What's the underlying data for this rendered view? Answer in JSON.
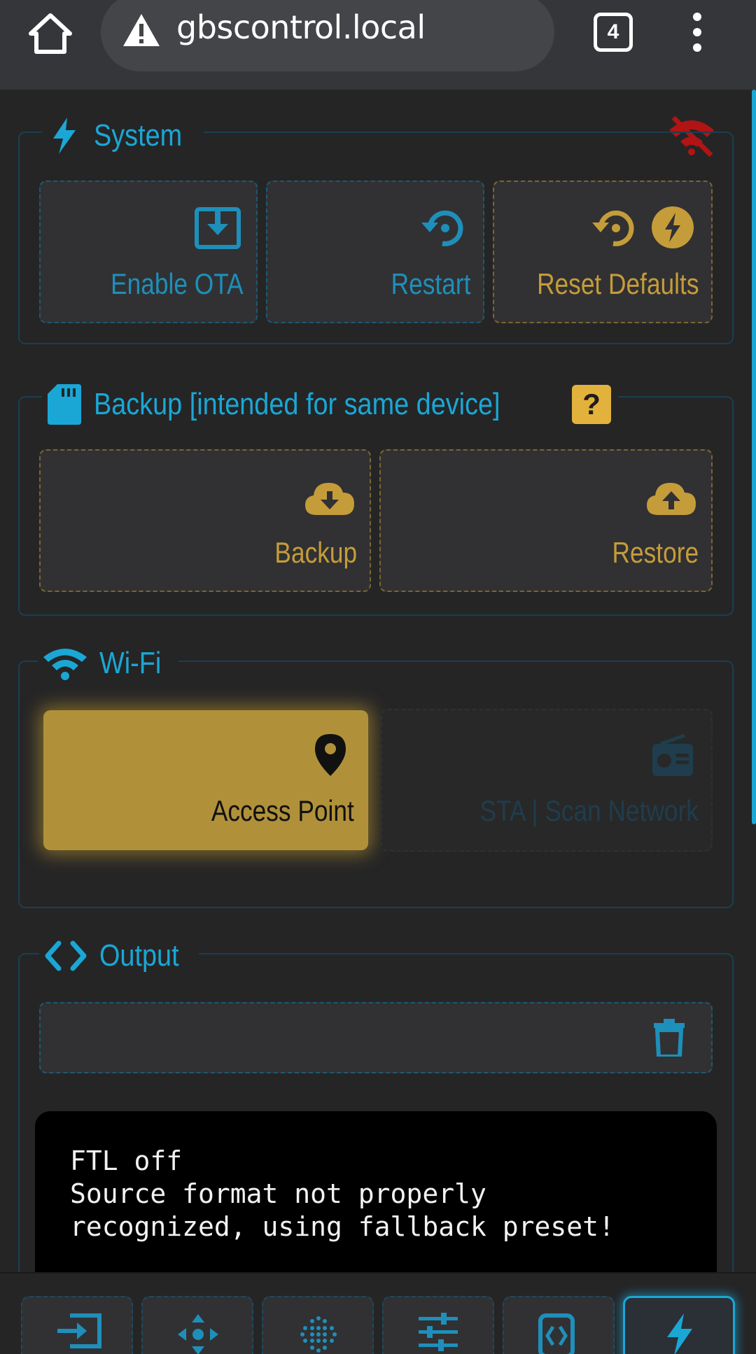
{
  "browser": {
    "url": "gbscontrol.local",
    "tab_count": "4"
  },
  "system": {
    "title": "System",
    "buttons": {
      "enable_ota": "Enable OTA",
      "restart": "Restart",
      "reset_defaults": "Reset Defaults"
    }
  },
  "backup": {
    "title": "Backup [intended for same device]",
    "help_label": "?",
    "buttons": {
      "backup": "Backup",
      "restore": "Restore"
    }
  },
  "wifi": {
    "title": "Wi-Fi",
    "buttons": {
      "access_point": "Access Point",
      "sta_scan": "STA | Scan Network"
    },
    "selected": "Access Point"
  },
  "output": {
    "title": "Output",
    "console_lines": [
      "FTL off",
      "Source format not properly",
      "recognized, using fallback preset!"
    ]
  },
  "colors": {
    "accent": "#1aa7d6",
    "gold": "#c59c3a",
    "background": "#252526",
    "warning_red": "#b01414"
  },
  "bottom_nav": {
    "items": [
      "input-icon",
      "move-icon",
      "scale-icon",
      "sliders-icon",
      "filter-icon",
      "lightning-icon"
    ],
    "active": "lightning-icon"
  }
}
